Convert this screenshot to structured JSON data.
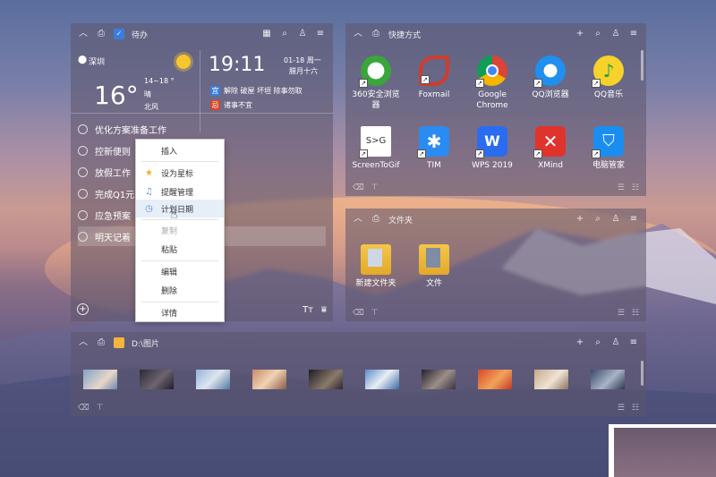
{
  "todo_panel": {
    "title": "待办",
    "weather": {
      "city": "深圳",
      "temp": "16°",
      "range": "14~18 °",
      "condition": "晴",
      "wind": "北风"
    },
    "clock": {
      "time": "19:11",
      "date": "01-18 周一",
      "lunar": "腊月十六",
      "good_label": "宜",
      "good": "解除 破屋 坏垣 除事勿取",
      "bad_label": "忌",
      "bad": "诸事不宜"
    },
    "items": [
      "优化方案准备工作",
      "控新便则",
      "放假工作",
      "完成Q1元",
      "应急预案",
      "明天记着"
    ]
  },
  "context_menu": {
    "items": [
      {
        "label": "插入",
        "icon": ""
      },
      {
        "label": "设为星标",
        "icon": "star-icon"
      },
      {
        "label": "提醒管理",
        "icon": "bell-icon"
      },
      {
        "label": "计划日期",
        "icon": "clock-icon"
      },
      {
        "label": "复制",
        "icon": ""
      },
      {
        "label": "粘贴",
        "icon": ""
      },
      {
        "label": "编辑",
        "icon": ""
      },
      {
        "label": "删除",
        "icon": ""
      },
      {
        "label": "详情",
        "icon": ""
      }
    ]
  },
  "shortcuts_panel": {
    "title": "快捷方式",
    "apps": [
      {
        "label": "360安全浏览器",
        "color": "#2ea52e"
      },
      {
        "label": "Foxmail",
        "color": "#d33b2a"
      },
      {
        "label": "Google Chrome",
        "color": "#4285f4"
      },
      {
        "label": "QQ浏览器",
        "color": "#1f8ff0"
      },
      {
        "label": "QQ音乐",
        "color": "#f6d22a"
      },
      {
        "label": "ScreenToGif",
        "color": "#ffffff"
      },
      {
        "label": "TIM",
        "color": "#2a8bf2"
      },
      {
        "label": "WPS 2019",
        "color": "#2a6cf0"
      },
      {
        "label": "XMind",
        "color": "#e0332c"
      },
      {
        "label": "电脑管家",
        "color": "#1a8ef0"
      }
    ]
  },
  "folders_panel": {
    "title": "文件夹",
    "items": [
      {
        "label": "新建文件夹"
      },
      {
        "label": "文件"
      }
    ]
  },
  "pictures_panel": {
    "title": "D:\\图片"
  }
}
